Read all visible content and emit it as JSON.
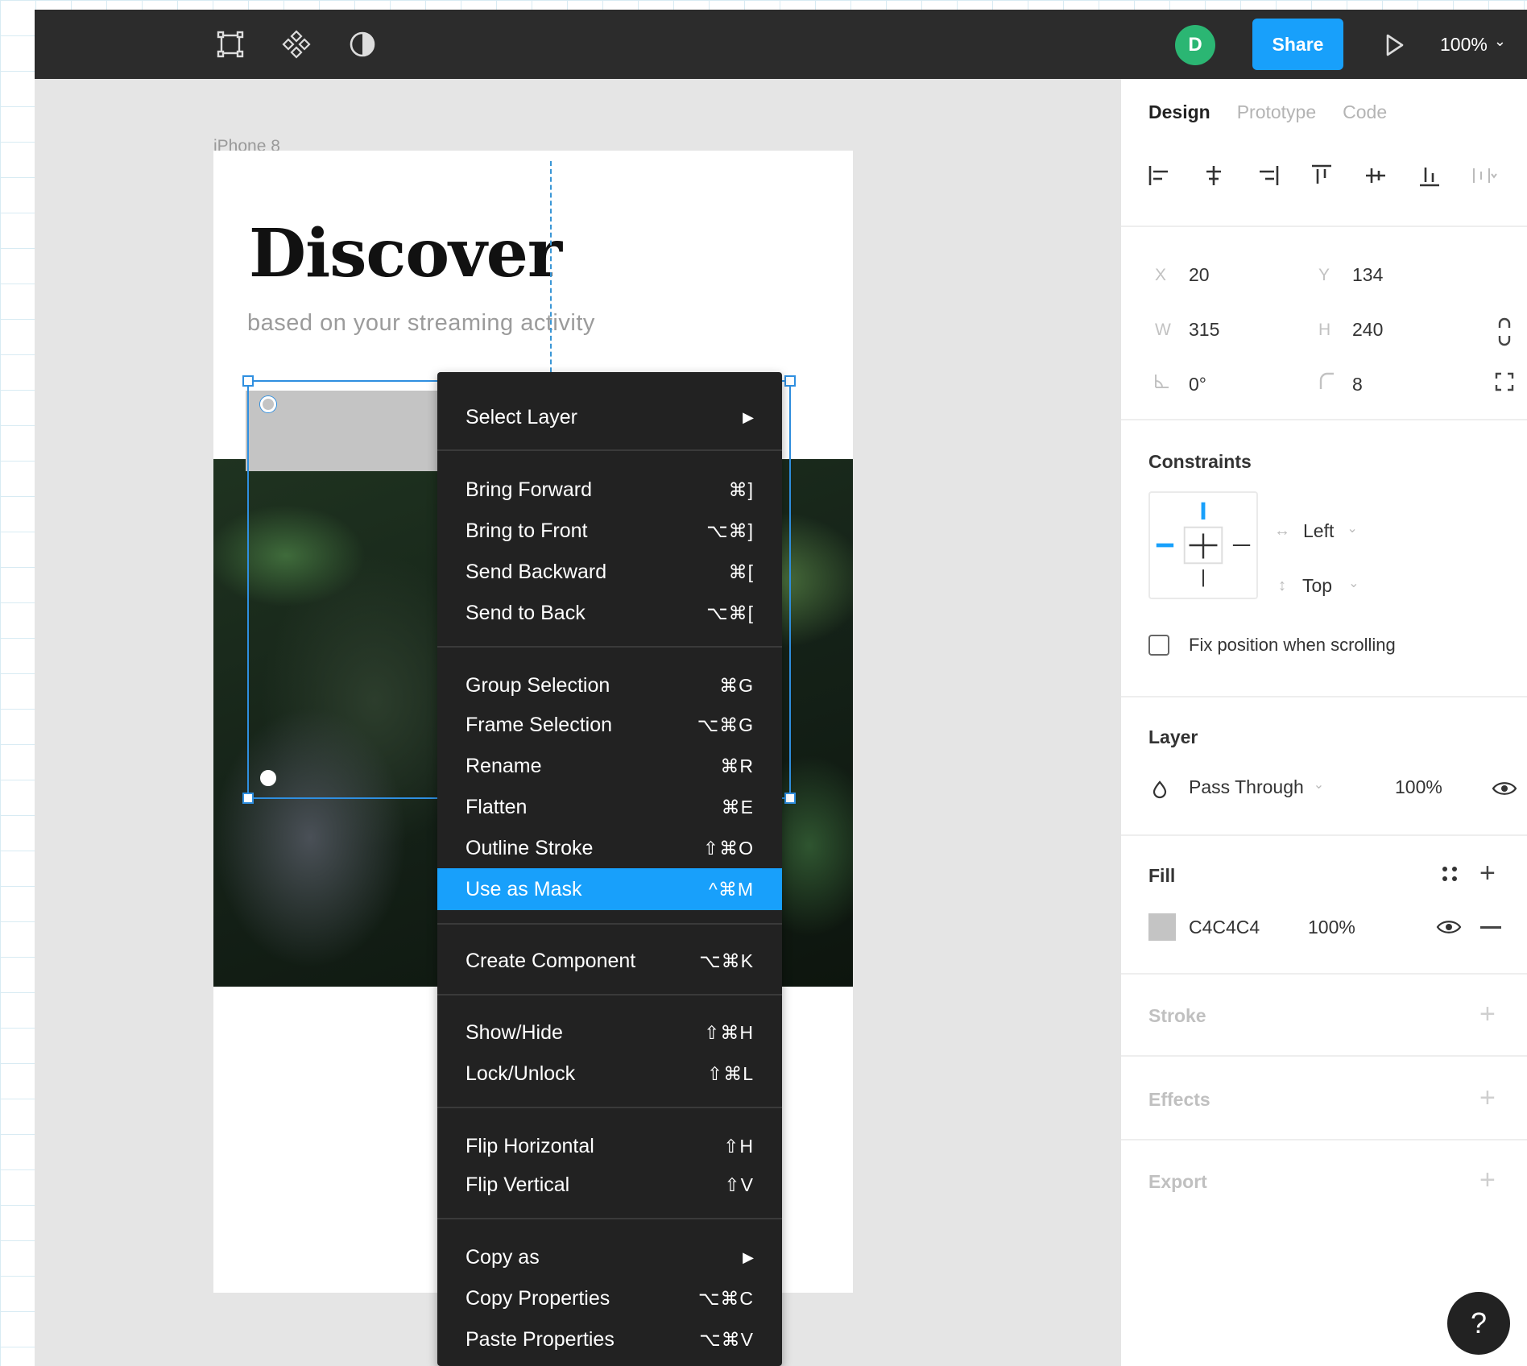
{
  "toolbar": {
    "tools": [
      "frame-tool-icon",
      "component-icon",
      "contrast-icon"
    ],
    "avatar_initial": "D",
    "share_label": "Share",
    "zoom_label": "100%",
    "zoom_chevron": "⌄"
  },
  "canvas": {
    "frame_label": "iPhone 8",
    "heading": "Discover",
    "subheading": "based on your streaming activity"
  },
  "context_menu": {
    "items": [
      {
        "label": "Select Layer",
        "shortcut": "▶"
      },
      {
        "label": "Bring Forward",
        "shortcut": "⌘]"
      },
      {
        "label": "Bring to Front",
        "shortcut": "⌥⌘]"
      },
      {
        "label": "Send Backward",
        "shortcut": "⌘["
      },
      {
        "label": "Send to Back",
        "shortcut": "⌥⌘["
      },
      {
        "label": "Group Selection",
        "shortcut": "⌘G"
      },
      {
        "label": "Frame Selection",
        "shortcut": "⌥⌘G"
      },
      {
        "label": "Rename",
        "shortcut": "⌘R"
      },
      {
        "label": "Flatten",
        "shortcut": "⌘E"
      },
      {
        "label": "Outline Stroke",
        "shortcut": "⇧⌘O"
      },
      {
        "label": "Use as Mask",
        "shortcut": "^⌘M"
      },
      {
        "label": "Create Component",
        "shortcut": "⌥⌘K"
      },
      {
        "label": "Show/Hide",
        "shortcut": "⇧⌘H"
      },
      {
        "label": "Lock/Unlock",
        "shortcut": "⇧⌘L"
      },
      {
        "label": "Flip Horizontal",
        "shortcut": "⇧H"
      },
      {
        "label": "Flip Vertical",
        "shortcut": "⇧V"
      },
      {
        "label": "Copy as",
        "shortcut": "▶"
      },
      {
        "label": "Copy Properties",
        "shortcut": "⌥⌘C"
      },
      {
        "label": "Paste Properties",
        "shortcut": "⌥⌘V"
      }
    ],
    "highlighted": "Use as Mask"
  },
  "panel": {
    "tabs": [
      "Design",
      "Prototype",
      "Code"
    ],
    "active_tab": "Design",
    "x_label": "X",
    "x_value": "20",
    "y_label": "Y",
    "y_value": "134",
    "w_label": "W",
    "w_value": "315",
    "h_label": "H",
    "h_value": "240",
    "rotation_value": "0°",
    "radius_value": "8",
    "constraints_title": "Constraints",
    "constraint_h": "Left",
    "constraint_v": "Top",
    "fix_position_label": "Fix position when scrolling",
    "layer_title": "Layer",
    "blend_mode": "Pass Through",
    "layer_opacity": "100%",
    "fill_title": "Fill",
    "fill_hex": "C4C4C4",
    "fill_opacity": "100%",
    "stroke_title": "Stroke",
    "effects_title": "Effects",
    "export_title": "Export",
    "chevron": "⌄"
  },
  "help_label": "?",
  "colors": {
    "accent": "#18a0fb",
    "avatar": "#2bb673",
    "fill": "#c4c4c4",
    "toolbar": "#2c2c2c"
  }
}
